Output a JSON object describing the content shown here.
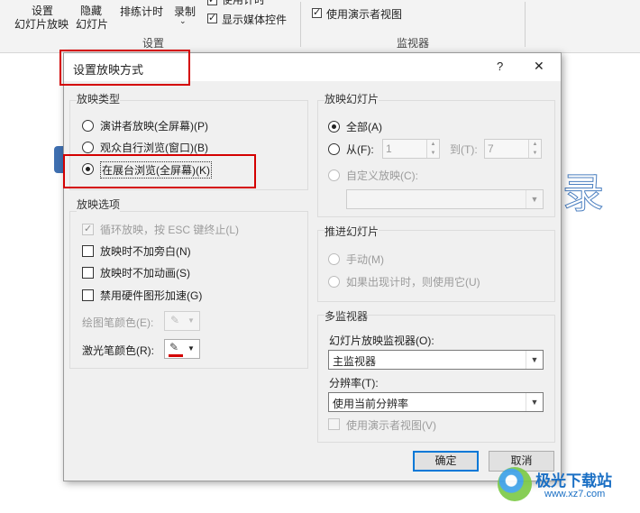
{
  "ribbon": {
    "setup_slideshow_line1": "设置",
    "setup_slideshow_line2": "幻灯片放映",
    "hide_slide_line1": "隐藏",
    "hide_slide_line2": "幻灯片",
    "rehearse_timings": "排练计时",
    "record_line1": "录制",
    "use_timings": "使用计时",
    "show_media_controls": "显示媒体控件",
    "use_presenter_view": "使用演示者视图",
    "group_setup": "设置",
    "group_monitors": "监视器"
  },
  "dialog": {
    "title": "设置放映方式",
    "help": "?",
    "close": "✕",
    "show_type": {
      "title": "放映类型",
      "options": [
        "演讲者放映(全屏幕)(P)",
        "观众自行浏览(窗口)(B)",
        "在展台浏览(全屏幕)(K)"
      ],
      "selected": 2
    },
    "show_options": {
      "title": "放映选项",
      "loop": "循环放映，按 ESC 键终止(L)",
      "no_narration": "放映时不加旁白(N)",
      "no_animation": "放映时不加动画(S)",
      "disable_hw_accel": "禁用硬件图形加速(G)",
      "pen_color": "绘图笔颜色(E):",
      "laser_color": "激光笔颜色(R):",
      "laser_color_value": "#d40000"
    },
    "show_slides": {
      "title": "放映幻灯片",
      "all": "全部(A)",
      "from": "从(F):",
      "from_value": "1",
      "to": "到(T):",
      "to_value": "7",
      "custom_show": "自定义放映(C):"
    },
    "advance": {
      "title": "推进幻灯片",
      "manual": "手动(M)",
      "use_timings": "如果出现计时，则使用它(U)"
    },
    "multi_monitor": {
      "title": "多监视器",
      "monitor_label": "幻灯片放映监视器(O):",
      "monitor_value": "主监视器",
      "resolution_label": "分辨率(T):",
      "resolution_value": "使用当前分辨率",
      "presenter_view": "使用演示者视图(V)"
    },
    "ok": "确定",
    "cancel": "取消"
  },
  "watermark": {
    "text": "极光下载站",
    "url": "www.xz7.com"
  }
}
